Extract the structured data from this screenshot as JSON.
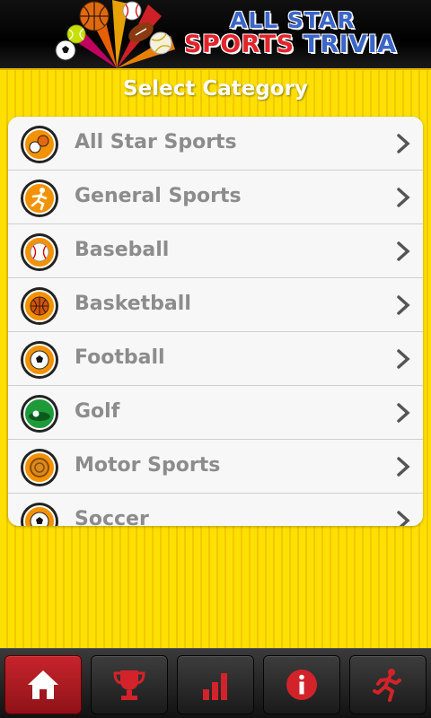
{
  "header": {
    "title_line1": "ALL STAR",
    "title_sports": "SPORTS",
    "title_trivia": "TRIVIA"
  },
  "main": {
    "heading": "Select Category",
    "categories": [
      {
        "label": "All Star Sports",
        "icon": "sports-mix-icon"
      },
      {
        "label": "General Sports",
        "icon": "runner-icon"
      },
      {
        "label": "Baseball",
        "icon": "baseball-icon"
      },
      {
        "label": "Basketball",
        "icon": "basketball-icon"
      },
      {
        "label": "Football",
        "icon": "soccer-ball-icon"
      },
      {
        "label": "Golf",
        "icon": "golf-icon"
      },
      {
        "label": "Motor Sports",
        "icon": "tire-icon"
      },
      {
        "label": "Soccer",
        "icon": "soccer-ball-icon"
      }
    ]
  },
  "tabbar": {
    "tabs": [
      {
        "name": "home",
        "icon": "home-icon",
        "active": true
      },
      {
        "name": "trophy",
        "icon": "trophy-icon",
        "active": false
      },
      {
        "name": "stats",
        "icon": "bar-chart-icon",
        "active": false
      },
      {
        "name": "info",
        "icon": "info-icon",
        "active": false
      },
      {
        "name": "play",
        "icon": "runner-icon",
        "active": false
      }
    ]
  },
  "colors": {
    "background_yellow": "#fde000",
    "stripe": "#f2c800",
    "active_tab_red": "#c8242c",
    "title_blue": "#3a66c8",
    "title_red": "#e3242b",
    "label_gray": "#8c8c8c"
  }
}
